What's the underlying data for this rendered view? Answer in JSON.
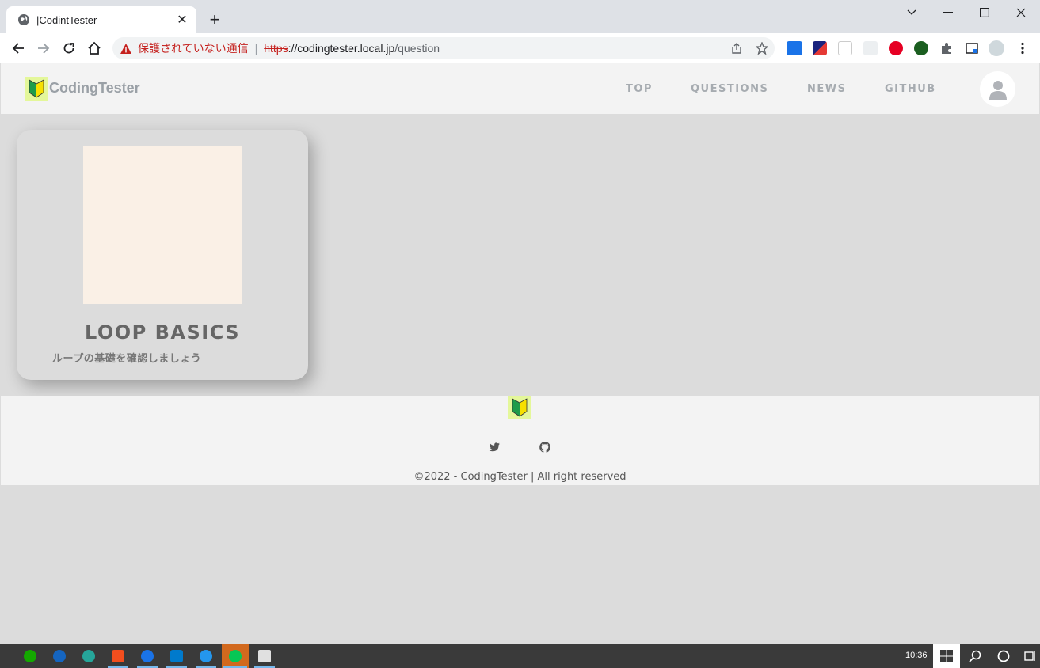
{
  "browser": {
    "tab_title": "|CodintTester",
    "security_label": "保護されていない通信",
    "url_scheme": "https",
    "url_rest_host": "://codingtester.local.jp",
    "url_path": "/question"
  },
  "site": {
    "brand": "CodingTester",
    "nav": [
      "TOP",
      "QUESTIONS",
      "NEWS",
      "GITHUB"
    ]
  },
  "card": {
    "title": "LOOP BASICS",
    "description": "ループの基礎を確認しましょう"
  },
  "footer": {
    "copyright": "©2022 - CodingTester | All right reserved"
  },
  "taskbar": {
    "clock": "10:36"
  },
  "colors": {
    "page_bg": "#dcdcdc",
    "header_bg": "#f3f3f3",
    "logo_bg": "#e4f79a",
    "thumb_bg": "#faf0e6"
  },
  "icons": [
    "globe-icon",
    "close-icon",
    "plus-icon",
    "back-arrow-icon",
    "forward-arrow-icon",
    "reload-icon",
    "home-icon",
    "warning-icon",
    "share-icon",
    "star-icon",
    "puzzle-icon",
    "menu-dots-icon",
    "beginner-mark-icon",
    "user-icon",
    "twitter-icon",
    "github-icon",
    "windows-icon",
    "search-icon",
    "cortana-icon",
    "task-view-icon"
  ]
}
